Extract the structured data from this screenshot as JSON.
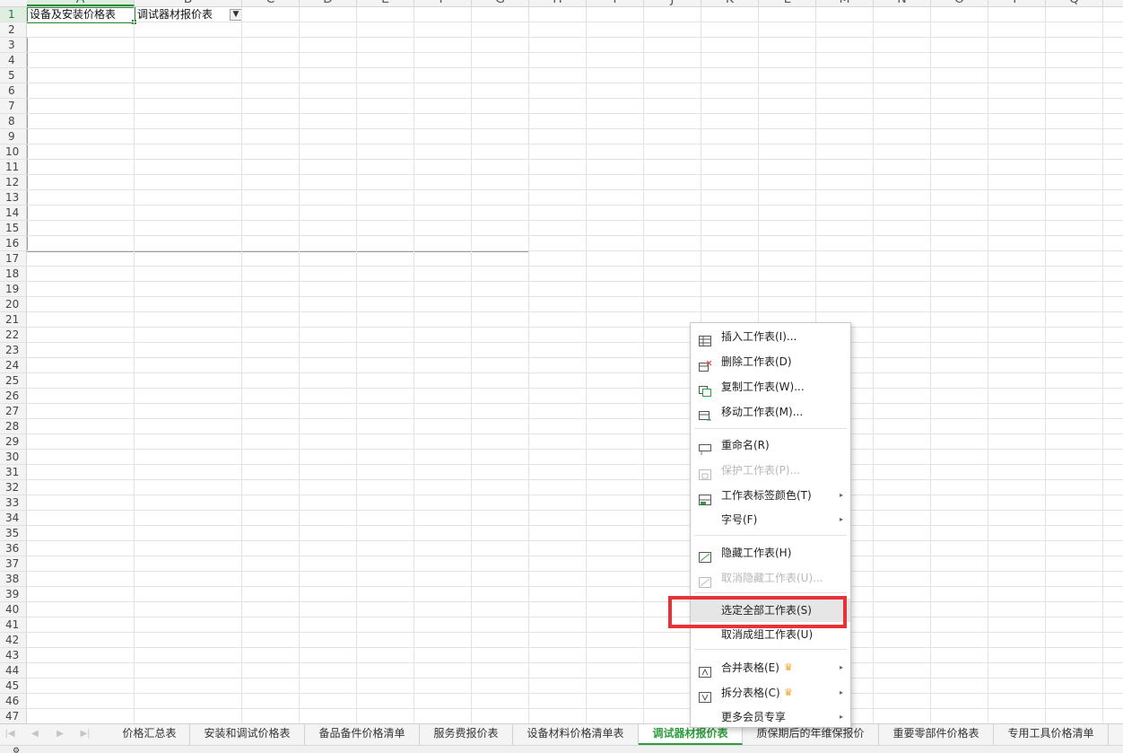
{
  "sheet": {
    "columns": [
      "A",
      "B",
      "C",
      "D",
      "E",
      "F",
      "G",
      "H",
      "I",
      "J",
      "K",
      "L",
      "M",
      "N",
      "O",
      "P",
      "Q"
    ],
    "selected_column": "A",
    "rows": [
      "1",
      "2",
      "3",
      "4",
      "5",
      "6",
      "7",
      "8",
      "9",
      "10",
      "11",
      "12",
      "13",
      "14",
      "15",
      "16",
      "17",
      "18",
      "19",
      "20",
      "21",
      "22",
      "23",
      "24",
      "25",
      "26",
      "27",
      "28",
      "29",
      "30",
      "31",
      "32",
      "33",
      "34",
      "35",
      "36",
      "37",
      "38",
      "39",
      "40",
      "41",
      "42",
      "43",
      "44",
      "45",
      "46",
      "47"
    ],
    "selected_row": "1",
    "cells": {
      "A1": "设备及安装价格表",
      "B1": "调试器材报价表"
    },
    "filter_icon": "filter-icon"
  },
  "tabs": [
    {
      "label": "价格汇总表",
      "active": false
    },
    {
      "label": "安装和调试价格表",
      "active": false
    },
    {
      "label": "备品备件价格清单",
      "active": false
    },
    {
      "label": "服务费报价表",
      "active": false
    },
    {
      "label": "设备材料价格清单表",
      "active": false
    },
    {
      "label": "调试器材报价表",
      "active": true
    },
    {
      "label": "质保期后的年维保报价",
      "active": false
    },
    {
      "label": "重要零部件价格表",
      "active": false
    },
    {
      "label": "专用工具价格清单",
      "active": false
    }
  ],
  "context_menu": {
    "items": [
      {
        "label": "插入工作表(I)...",
        "icon": "insert-sheet-icon",
        "enabled": true
      },
      {
        "label": "删除工作表(D)",
        "icon": "delete-sheet-icon",
        "enabled": true
      },
      {
        "label": "复制工作表(W)...",
        "icon": "copy-sheet-icon",
        "enabled": true
      },
      {
        "label": "移动工作表(M)...",
        "icon": "move-sheet-icon",
        "enabled": true
      },
      {
        "label": "重命名(R)",
        "icon": "rename-icon",
        "enabled": true
      },
      {
        "label": "保护工作表(P)...",
        "icon": "protect-sheet-icon",
        "enabled": false
      },
      {
        "label": "工作表标签颜色(T)",
        "icon": "tab-color-icon",
        "enabled": true,
        "submenu": true
      },
      {
        "label": "字号(F)",
        "icon": "",
        "enabled": true,
        "submenu": true
      },
      {
        "label": "隐藏工作表(H)",
        "icon": "hide-sheet-icon",
        "enabled": true
      },
      {
        "label": "取消隐藏工作表(U)...",
        "icon": "unhide-sheet-icon",
        "enabled": false
      },
      {
        "label": "选定全部工作表(S)",
        "icon": "",
        "enabled": true,
        "highlighted": true
      },
      {
        "label": "取消成组工作表(U)",
        "icon": "",
        "enabled": true
      },
      {
        "label": "合并表格(E)",
        "icon": "merge-table-icon",
        "enabled": true,
        "submenu": true,
        "premium": true
      },
      {
        "label": "拆分表格(C)",
        "icon": "split-table-icon",
        "enabled": true,
        "submenu": true,
        "premium": true
      },
      {
        "label": "更多会员专享",
        "icon": "",
        "enabled": true,
        "submenu": true
      }
    ]
  },
  "colors": {
    "accent_green": "#2e9e3c",
    "highlight_red": "#e8323a",
    "crown_gold": "#f0a020"
  }
}
